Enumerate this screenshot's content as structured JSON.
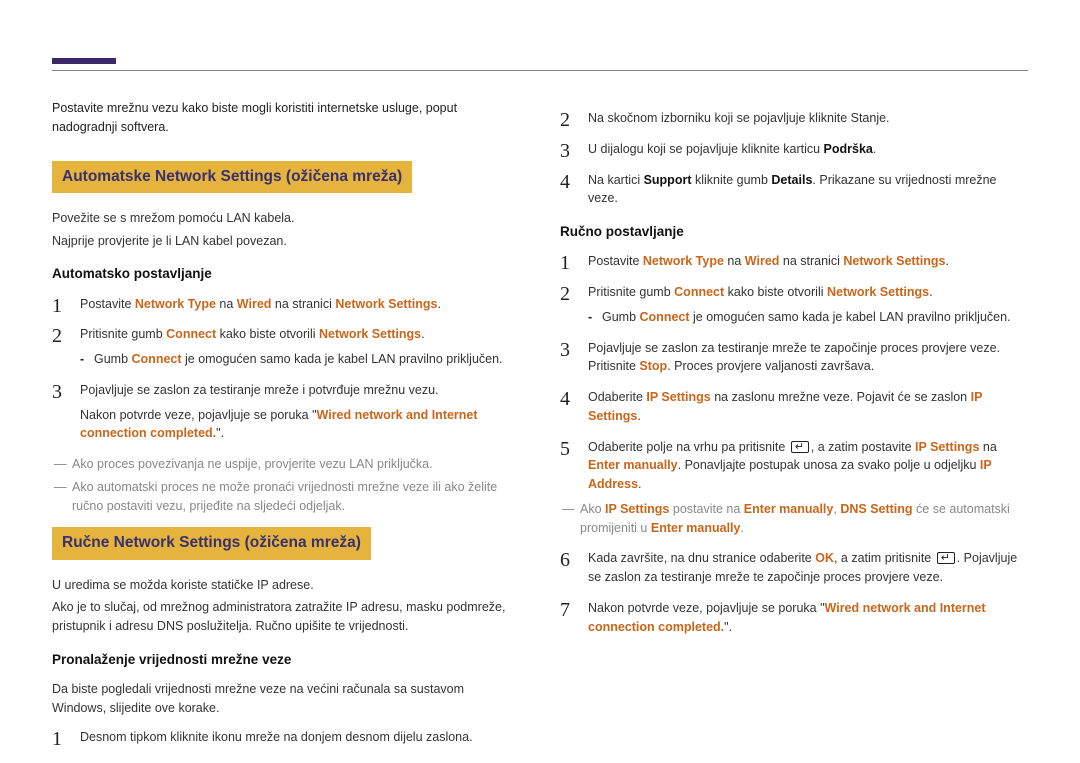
{
  "intro": "Postavite mrežnu vezu kako biste mogli koristiti internetske usluge, poput nadogradnji softvera.",
  "left": {
    "section1_title": "Automatske Network Settings  (ožičena mreža)",
    "section1_p1": "Povežite se s mrežom pomoću LAN kabela.",
    "section1_p2": "Najprije provjerite je li LAN kabel povezan.",
    "auto_heading": "Automatsko postavljanje",
    "auto_step1_pre": "Postavite ",
    "auto_step1_hl1": "Network Type",
    "auto_step1_mid": " na ",
    "auto_step1_hl2": "Wired",
    "auto_step1_mid2": " na stranici ",
    "auto_step1_hl3": "Network Settings",
    "auto_step1_post": ".",
    "auto_step2_pre": "Pritisnite gumb ",
    "auto_step2_hl1": "Connect",
    "auto_step2_mid": " kako biste otvorili ",
    "auto_step2_hl2": "Network Settings",
    "auto_step2_post": ".",
    "auto_step2_sub_pre": "Gumb ",
    "auto_step2_sub_hl": "Connect",
    "auto_step2_sub_post": " je omogućen samo kada je kabel LAN pravilno priključen.",
    "auto_step3": "Pojavljuje se zaslon za testiranje mreže i potvrđuje mrežnu vezu.",
    "auto_after_pre": "Nakon potvrde veze, pojavljuje se poruka \"",
    "auto_after_hl": "Wired network and Internet connection completed.",
    "auto_after_post": "\".",
    "auto_note1": "Ako proces povezivanja ne uspije, provjerite vezu LAN priključka.",
    "auto_note2": "Ako automatski proces ne može pronaći vrijednosti mrežne veze ili ako želite ručno postaviti vezu, prijeđite na sljedeći odjeljak.",
    "section2_title": "Ručne Network Settings  (ožičena mreža)",
    "section2_p1": "U uredima se možda koriste statičke IP adrese.",
    "section2_p2": "Ako je to slučaj, od mrežnog administratora zatražite IP adresu, masku podmreže, pristupnik i adresu DNS poslužitelja. Ručno upišite te vrijednosti.",
    "find_heading": "Pronalaženje vrijednosti mrežne veze",
    "find_intro": "Da biste pogledali vrijednosti mrežne veze na većini računala sa sustavom Windows, slijedite ove korake.",
    "find_step1": "Desnom tipkom kliknite ikonu mreže na donjem desnom dijelu zaslona."
  },
  "right": {
    "step2": "Na skočnom izborniku koji se pojavljuje kliknite Stanje.",
    "step3_pre": "U dijalogu koji se pojavljuje kliknite karticu ",
    "step3_b": "Podrška",
    "step3_post": ".",
    "step4_pre": "Na kartici ",
    "step4_b1": "Support",
    "step4_mid": " kliknite gumb ",
    "step4_b2": "Details",
    "step4_post": ". Prikazane su vrijednosti mrežne veze.",
    "manual_heading": "Ručno postavljanje",
    "m1_pre": "Postavite ",
    "m1_hl1": "Network Type",
    "m1_mid": " na ",
    "m1_hl2": "Wired",
    "m1_mid2": " na stranici ",
    "m1_hl3": "Network Settings",
    "m1_post": ".",
    "m2_pre": "Pritisnite gumb ",
    "m2_hl1": "Connect",
    "m2_mid": " kako biste otvorili ",
    "m2_hl2": "Network Settings",
    "m2_post": ".",
    "m2_sub_pre": "Gumb ",
    "m2_sub_hl": "Connect",
    "m2_sub_post": " je omogućen samo kada je kabel LAN pravilno priključen.",
    "m3_pre": "Pojavljuje se zaslon za testiranje mreže te započinje proces provjere veze. Pritisnite ",
    "m3_hl": "Stop",
    "m3_post": ". Proces provjere valjanosti završava.",
    "m4_pre": "Odaberite ",
    "m4_hl1": "IP Settings",
    "m4_mid": " na zaslonu mrežne veze. Pojavit će se zaslon ",
    "m4_hl2": "IP Settings",
    "m4_post": ".",
    "m5_pre": "Odaberite polje na vrhu pa pritisnite ",
    "m5_mid": ", a zatim postavite ",
    "m5_hl1": "IP Settings",
    "m5_mid2": " na ",
    "m5_hl2": "Enter manually",
    "m5_post": ". Ponavljajte postupak unosa za svako polje u odjeljku ",
    "m5_hl3": "IP Address",
    "m5_end": ".",
    "m5_note_pre": "Ako ",
    "m5_note_hl1": "IP Settings",
    "m5_note_mid1": " postavite na ",
    "m5_note_hl2": "Enter manually",
    "m5_note_mid2": ", ",
    "m5_note_hl3": "DNS Setting",
    "m5_note_mid3": " će se automatski promijeniti u ",
    "m5_note_hl4": "Enter manually",
    "m5_note_post": ".",
    "m6_pre": "Kada završite, na dnu stranice odaberite ",
    "m6_hl1": "OK",
    "m6_mid": ", a zatim pritisnite ",
    "m6_post": ". Pojavljuje se zaslon za testiranje mreže te započinje proces provjere veze.",
    "m7_pre": "Nakon potvrde veze, pojavljuje se poruka \"",
    "m7_hl": "Wired network and Internet connection completed.",
    "m7_post": "\"."
  }
}
